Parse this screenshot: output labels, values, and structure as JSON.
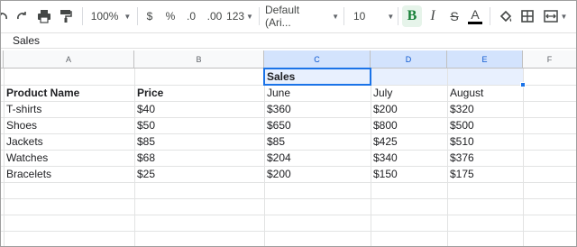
{
  "toolbar": {
    "zoom": "100%",
    "currency": "$",
    "percent": "%",
    "decrease_decimal": ".0",
    "increase_decimal": ".00",
    "more_formats": "123",
    "font": "Default (Ari...",
    "font_size": "10",
    "bold": "B",
    "italic": "I",
    "strikethrough": "S",
    "text_color": "A"
  },
  "formula_bar": {
    "value": "Sales"
  },
  "columns": [
    "A",
    "B",
    "C",
    "D",
    "E",
    "F"
  ],
  "sheet": {
    "merged_header": "Sales",
    "headers": [
      "Product Name",
      "Price",
      "June",
      "July",
      "August"
    ],
    "rows": [
      [
        "T-shirts",
        "$40",
        "$360",
        "$200",
        "$320"
      ],
      [
        "Shoes",
        "$50",
        "$650",
        "$800",
        "$500"
      ],
      [
        "Jackets",
        "$85",
        "$85",
        "$425",
        "$510"
      ],
      [
        "Watches",
        "$68",
        "$204",
        "$340",
        "$376"
      ],
      [
        "Bracelets",
        "$25",
        "$200",
        "$150",
        "$175"
      ]
    ]
  },
  "colors": {
    "selection": "#1a73e8",
    "selection_fill": "#e8f0fe",
    "bold_active": "#188038"
  }
}
